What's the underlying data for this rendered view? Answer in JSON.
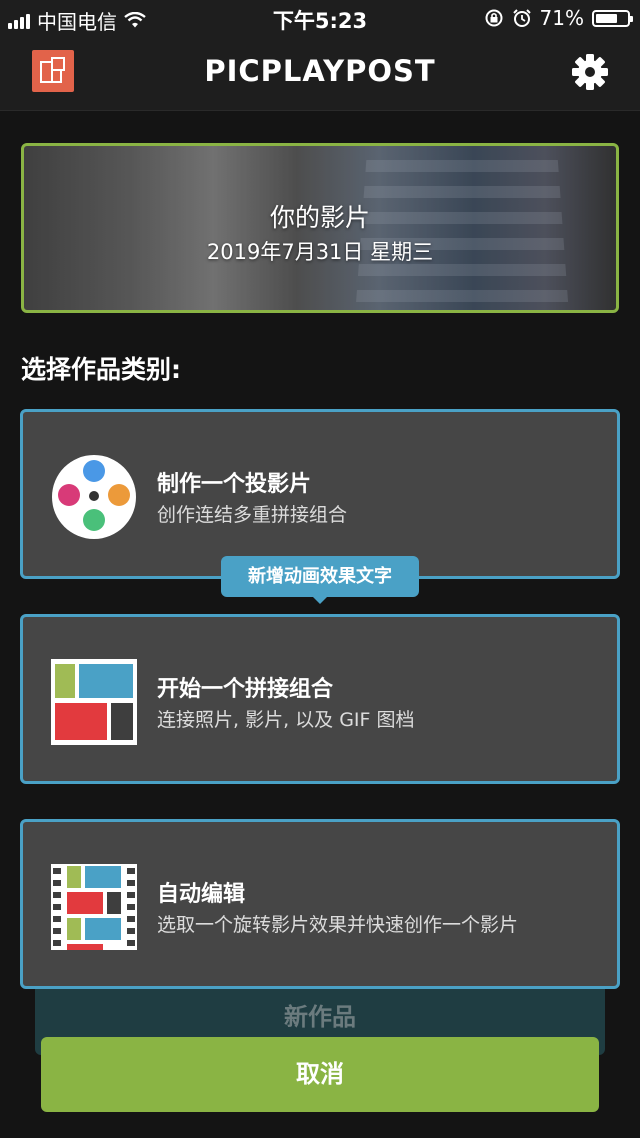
{
  "status_bar": {
    "carrier": "中国电信",
    "time": "下午5:23",
    "battery": "71%",
    "battery_level": 0.71
  },
  "nav": {
    "title": "PICPLAYPOST"
  },
  "hero": {
    "title": "你的影片",
    "date": "2019年7月31日 星期三"
  },
  "section_label": "选择作品类别:",
  "options": [
    {
      "title": "制作一个投影片",
      "subtitle": "创作连结多重拼接组合"
    },
    {
      "title": "开始一个拼接组合",
      "subtitle": "连接照片, 影片, 以及 GIF 图档"
    },
    {
      "title": "自动编辑",
      "subtitle": "选取一个旋转影片效果并快速创作一个影片"
    }
  ],
  "tooltip": "新增动画效果文字",
  "new_work_label": "新作品",
  "cancel_label": "取消",
  "colors": {
    "accent_green": "#8ab444",
    "accent_blue": "#4aa1c6",
    "logo_orange": "#e2634a",
    "card_bg": "#464646"
  }
}
